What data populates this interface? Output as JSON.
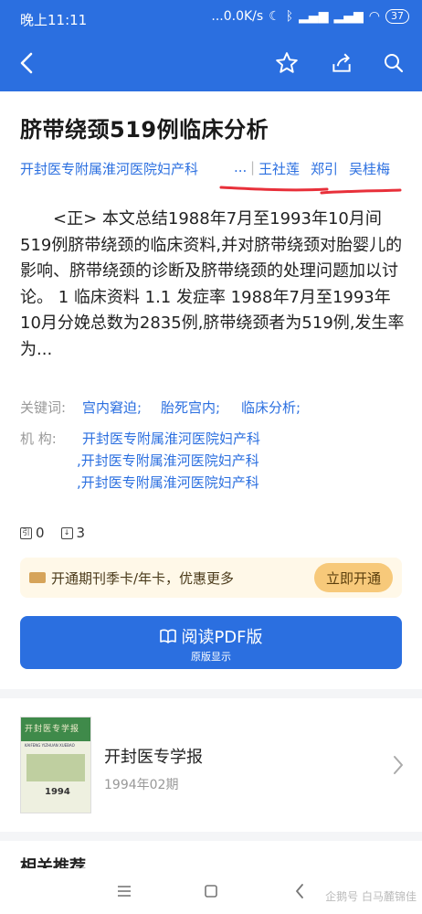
{
  "status": {
    "time": "晚上11:11",
    "network": "...0.0K/s",
    "battery": "37"
  },
  "appbar": {
    "back_icon": "back-arrow-icon",
    "favorite_icon": "star-icon",
    "share_icon": "share-icon",
    "search_icon": "search-icon"
  },
  "article": {
    "title": "脐带绕颈519例临床分析",
    "institution": "开封医专附属淮河医院妇产科",
    "ellipsis": "...",
    "authors": [
      "王社莲",
      "郑引",
      "吴桂梅"
    ],
    "abstract": "<正> 本文总结1988年7月至1993年10月间519例脐带绕颈的临床资料,并对脐带绕颈对胎婴儿的影响、脐带绕颈的诊断及脐带绕颈的处理问题加以讨论。 1 临床资料 1.1 发症率 1988年7月至1993年10月分娩总数为2835例,脐带绕颈者为519例,发生率为...",
    "keywords_label": "关键词:",
    "keywords": [
      "宫内窘迫;",
      "胎死宫内;",
      "临床分析;"
    ],
    "org_label": "机    构:",
    "orgs": [
      "开封医专附属淮河医院妇产科",
      ",开封医专附属淮河医院妇产科",
      ",开封医专附属淮河医院妇产科"
    ],
    "cite_count": "0",
    "download_count": "3"
  },
  "promo": {
    "text": "开通期刊季卡/年卡，优惠更多",
    "button": "立即开通"
  },
  "read_button": {
    "label": "阅读PDF版",
    "sub": "原版显示"
  },
  "journal": {
    "cover_title": "开封医专学报",
    "cover_en": "KAIFENG YIZHUAN XUEBAO",
    "cover_year": "1994",
    "name": "开封医专学报",
    "issue": "1994年02期"
  },
  "related": {
    "title": "相关推荐"
  },
  "watermark": "企鹅号 白马麓锦佳",
  "colors": {
    "primary": "#2b6fe0",
    "promo_bg": "#fff8e8",
    "promo_button": "#f7c97a",
    "annotation_red": "#e8303a"
  }
}
